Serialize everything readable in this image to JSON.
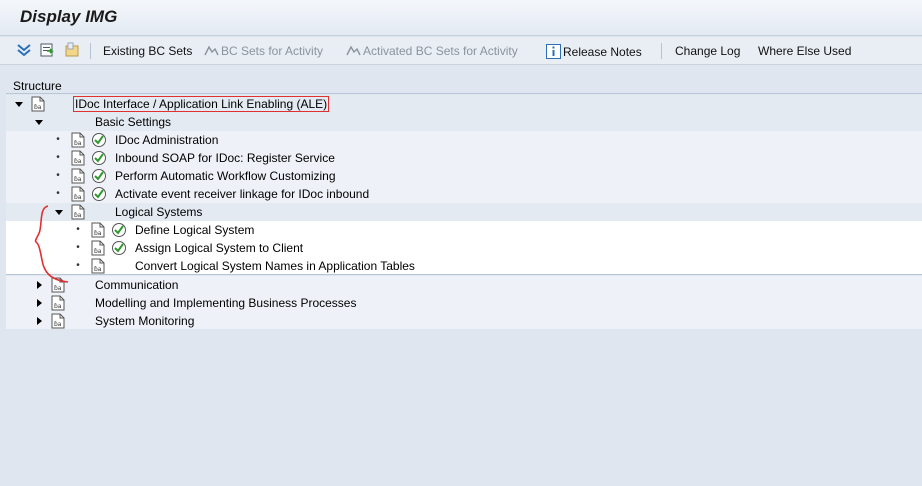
{
  "window": {
    "title": "Display IMG"
  },
  "toolbar": {
    "existing_bc_sets": "Existing BC Sets",
    "bc_sets_for_activity": "BC Sets for Activity",
    "activated_bc_sets_for_activity": "Activated BC Sets for Activity",
    "release_notes": "Release Notes",
    "change_log": "Change Log",
    "where_else_used": "Where Else Used"
  },
  "structure": {
    "header": "Structure",
    "root": {
      "label": "IDoc Interface / Application Link Enabling (ALE)",
      "expanded": true
    },
    "basic_settings": {
      "label": "Basic Settings",
      "expanded": true,
      "items": [
        {
          "label": "IDoc Administration",
          "has_check": true
        },
        {
          "label": "Inbound SOAP for IDoc: Register Service",
          "has_check": true
        },
        {
          "label": "Perform Automatic Workflow Customizing",
          "has_check": true
        },
        {
          "label": "Activate event receiver linkage for IDoc inbound",
          "has_check": true
        }
      ]
    },
    "logical_systems": {
      "label": "Logical Systems",
      "expanded": true,
      "items": [
        {
          "label": "Define Logical System",
          "has_check": true
        },
        {
          "label": "Assign Logical System to Client",
          "has_check": true
        },
        {
          "label": "Convert Logical System Names in Application Tables",
          "has_check": false
        }
      ]
    },
    "collapsed_nodes": [
      {
        "label": "Communication"
      },
      {
        "label": "Modelling and Implementing Business Processes"
      },
      {
        "label": "System Monitoring"
      }
    ]
  },
  "colors": {
    "annotation_red": "#e03030",
    "tree_band": "#e3eaf2",
    "tree_band_light": "#eef2f8",
    "background": "#dfe6ef"
  }
}
